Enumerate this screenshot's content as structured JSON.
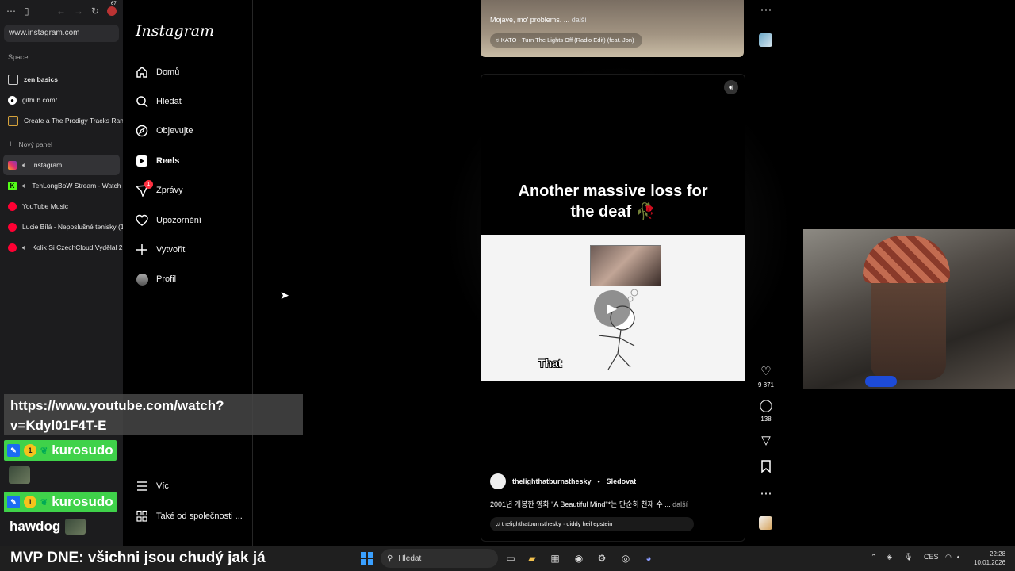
{
  "browser": {
    "url": "www.instagram.com",
    "notif_count": "67",
    "space_label": "Space",
    "pinned": [
      {
        "label": "zen basics"
      },
      {
        "label": "github.com/"
      },
      {
        "label": "Create a The Prodigy Tracks Rank"
      }
    ],
    "new_panel": "Nový panel",
    "tabs": [
      {
        "label": "Instagram"
      },
      {
        "label": "TehLongBoW Stream - Watch"
      },
      {
        "label": "YouTube Music"
      },
      {
        "label": "Lucie Bílá - Neposlušné tenisky (1"
      },
      {
        "label": "Kolik Si CzechCloud Vydělal 2"
      }
    ]
  },
  "instagram": {
    "logo": "Instagram",
    "nav": {
      "home": "Domů",
      "search": "Hledat",
      "explore": "Objevujte",
      "reels": "Reels",
      "messages": "Zprávy",
      "messages_badge": "1",
      "notifications": "Upozornění",
      "create": "Vytvořit",
      "profile": "Profil",
      "more": "Víc",
      "also_from": "Také od společnosti ..."
    }
  },
  "prev_post": {
    "caption": "Mojave, mo' problems. ...",
    "more": "další",
    "music": "KATO · Turn The Lights Off (Radio Edit) (feat. Jon)"
  },
  "reel": {
    "title_line1": "Another massive loss for",
    "title_line2": "the deaf 🥀",
    "subtitle": "That",
    "author": "thelighthatburnsthesky",
    "follow": "Sledovat",
    "caption": "2001년 개봉한 영화 \"A Beautiful Mind\"*는 단순히 천재 수 ...",
    "more": "další",
    "music": "thelighthatburnsthesky · diddy heil epstein",
    "likes": "9 871",
    "comments": "138"
  },
  "overlay": {
    "link": "https://www.youtube.com/watch?v=Kdyl01F4T-E",
    "chat_user1": "kurosudo",
    "chat_user2": "kurosudo",
    "badge_level": "1",
    "chat_user3": "hawdog",
    "mvp": "MVP DNE: všichni jsou chudý jak já"
  },
  "taskbar": {
    "search": "Hledat",
    "lang": "CES",
    "time": "22:28",
    "date": "10.01.2026"
  }
}
